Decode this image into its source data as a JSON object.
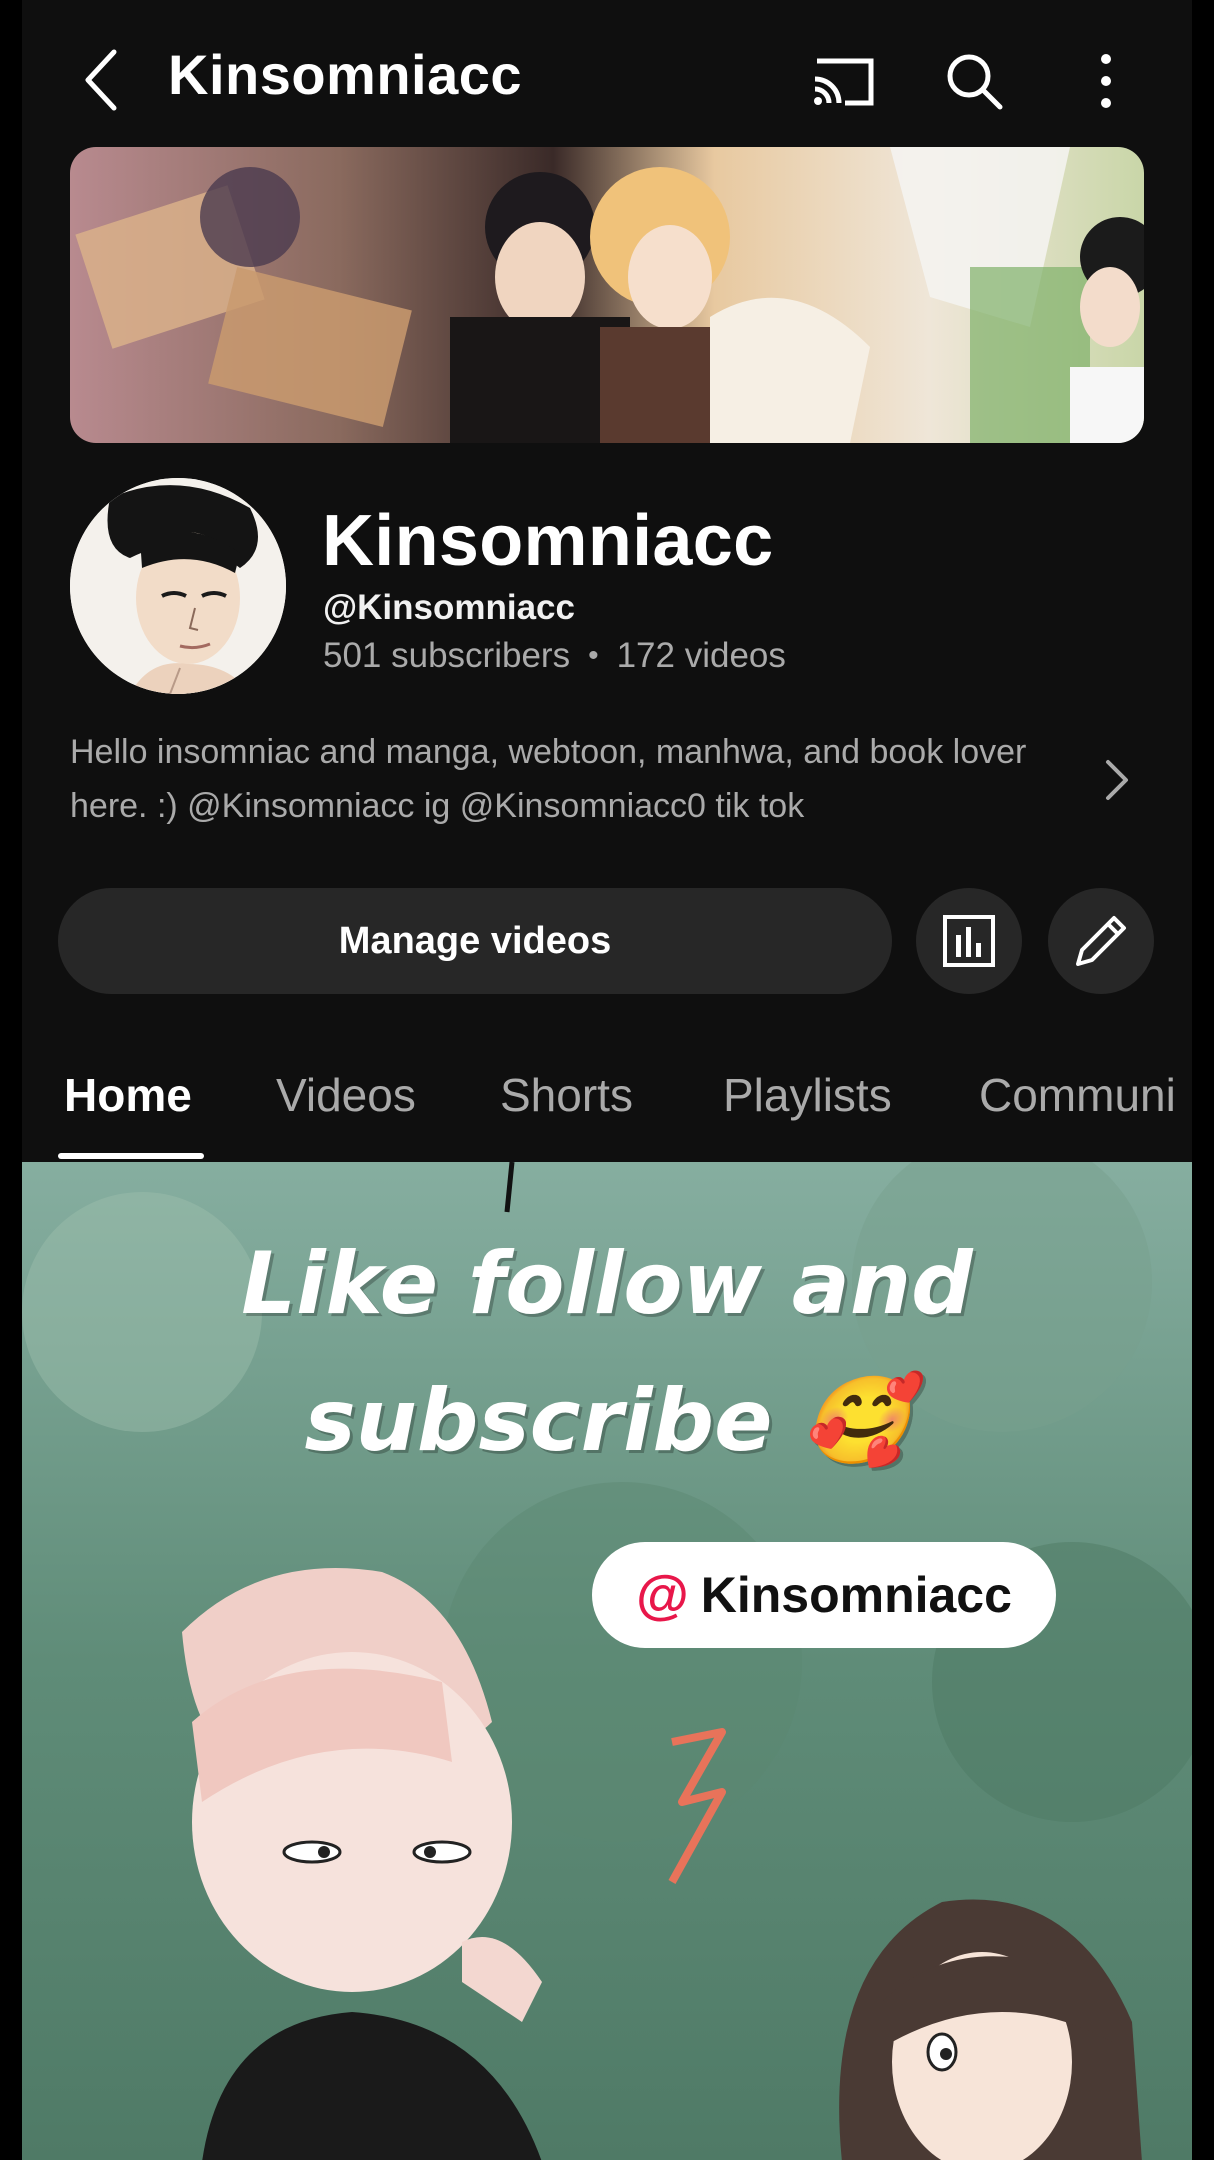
{
  "topbar": {
    "title": "Kinsomniacc",
    "icons": [
      "back-icon",
      "cast-icon",
      "search-icon",
      "more-vert-icon"
    ]
  },
  "channel": {
    "name": "Kinsomniacc",
    "handle": "@Kinsomniacc",
    "subscribers": "501 subscribers",
    "separator": "•",
    "videos": "172 videos",
    "description": "Hello insomniac and manga, webtoon, manhwa, and book lover here. :) @Kinsomniacc ig @Kinsomniacc0 tik tok"
  },
  "actions": {
    "manage_label": "Manage videos",
    "icons": [
      "analytics-icon",
      "edit-pencil-icon"
    ]
  },
  "tabs": [
    {
      "label": "Home",
      "active": true
    },
    {
      "label": "Videos",
      "active": false
    },
    {
      "label": "Shorts",
      "active": false
    },
    {
      "label": "Playlists",
      "active": false
    },
    {
      "label": "Communi",
      "active": false
    }
  ],
  "feature": {
    "line1": "Like follow and",
    "line2": "subscribe 🥰",
    "tag_at": "@",
    "tag_name": "Kinsomniacc"
  },
  "colors": {
    "background": "#0f0f0f",
    "button_bg": "#272727",
    "secondary_text": "#aaaaaa",
    "tag_accent": "#e8174a"
  }
}
